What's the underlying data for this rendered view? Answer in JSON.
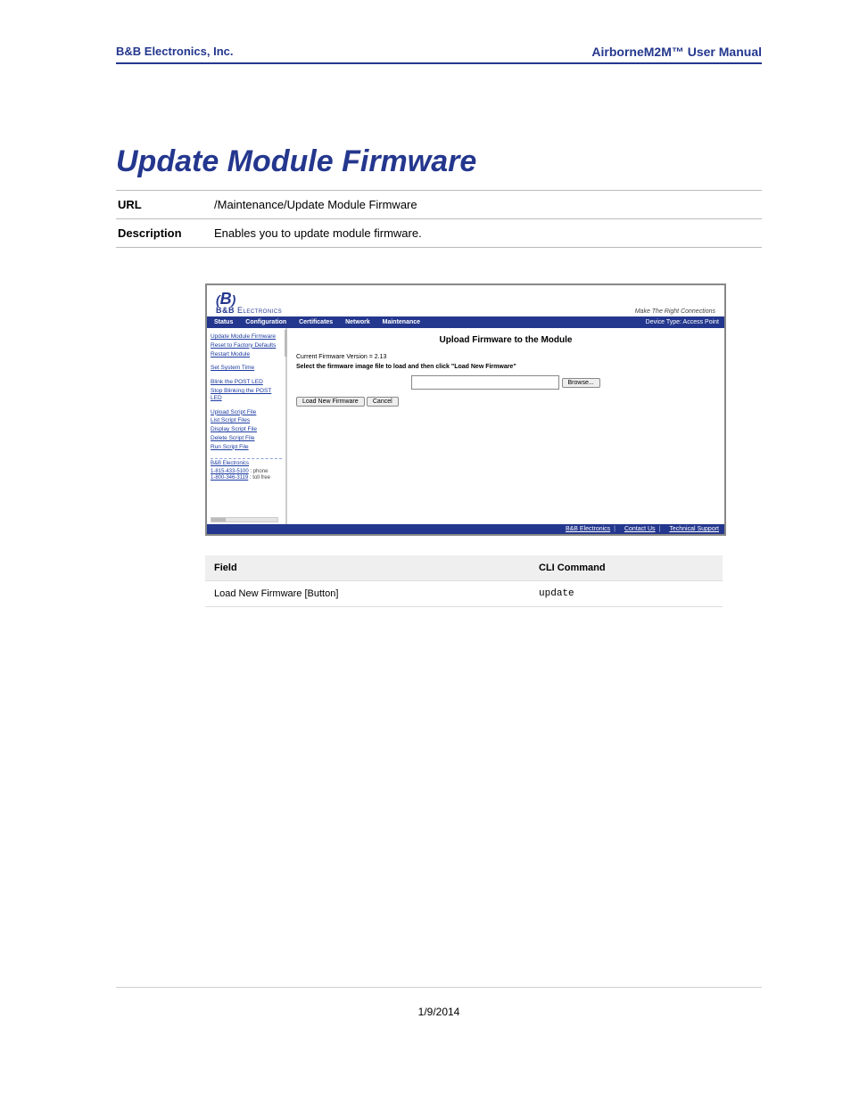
{
  "header": {
    "company": "B&B Electronics, Inc.",
    "manual": "AirborneM2M™ User Manual"
  },
  "title": "Update Module Firmware",
  "meta": {
    "url_label": "URL",
    "url_value": "/Maintenance/Update Module Firmware",
    "desc_label": "Description",
    "desc_value": "Enables you to update module firmware."
  },
  "ui": {
    "logo_line1": "B",
    "logo_lpar": "(",
    "logo_rpar": ")",
    "logo_line2_bb": "B&B",
    "logo_line2_elec": " Electronics",
    "tagline": "Make The Right Connections",
    "nav": {
      "tabs": [
        "Status",
        "Configuration",
        "Certificates",
        "Network",
        "Maintenance"
      ],
      "device_type": "Device Type: Access Point"
    },
    "sidebar": {
      "grp1": [
        "Update Module Firmware",
        "Reset to Factory Defaults",
        "Restart Module"
      ],
      "grp2": [
        "Set System Time"
      ],
      "grp3": [
        "Blink the POST LED",
        "Stop Blinking the POST LED"
      ],
      "grp4": [
        "Upload Script File",
        "List Script Files",
        "Display Script File",
        "Delete Script File",
        "Run Script File"
      ],
      "contact_title": "B&B Electronics",
      "phone1": "1-815-433-5100",
      "phone1_label": "phone",
      "phone2": "1-800-346-3119",
      "phone2_label": "toll free"
    },
    "content": {
      "heading": "Upload Firmware to the Module",
      "version": "Current Firmware Version = 2.13",
      "instruction": "Select the firmware image file to load and then click \"Load New Firmware\"",
      "browse": "Browse...",
      "load_btn": "Load New Firmware",
      "cancel_btn": "Cancel"
    },
    "footer": {
      "link1": "B&B Electronics",
      "link2": "Contact Us",
      "link3": "Technical Support"
    }
  },
  "cli_table": {
    "head_field": "Field",
    "head_cmd": "CLI Command",
    "row_field": "Load New Firmware [Button]",
    "row_cmd": "update"
  },
  "footer_date": "1/9/2014"
}
